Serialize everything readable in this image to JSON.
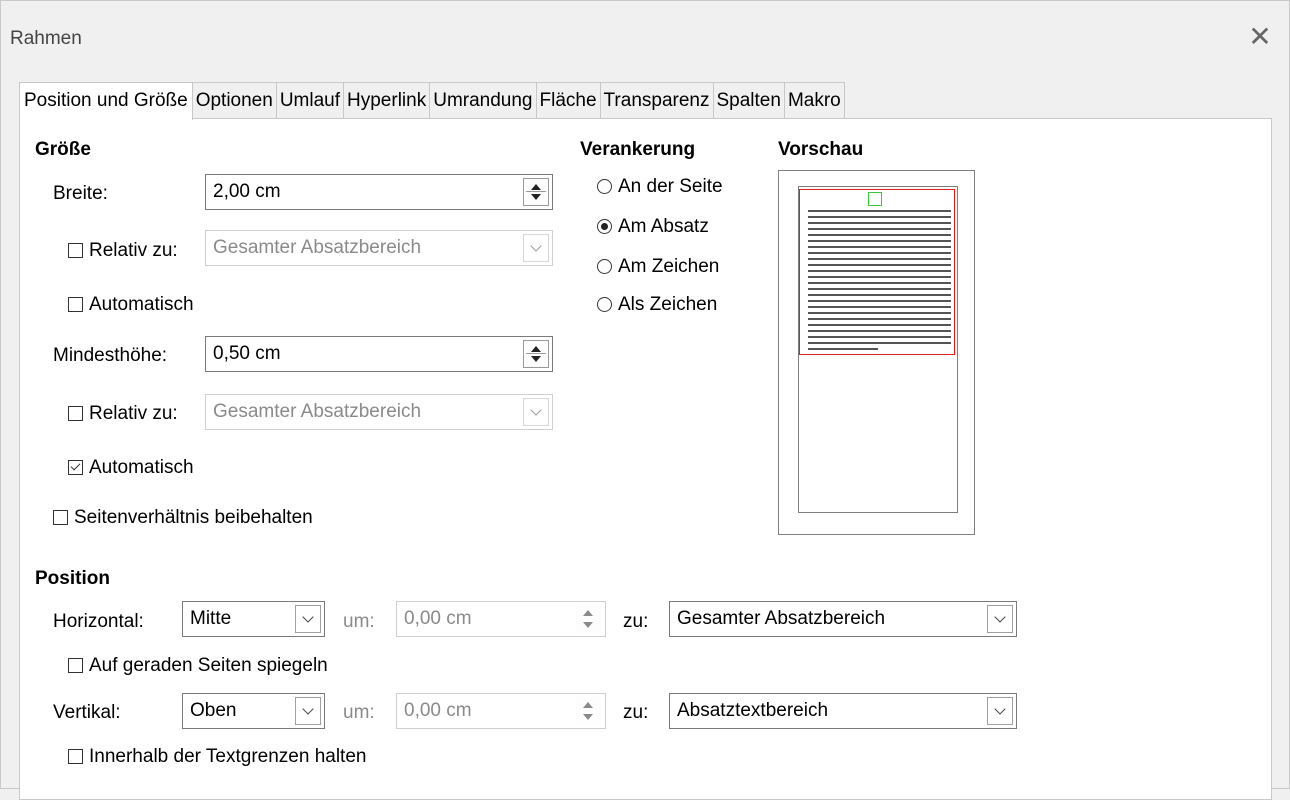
{
  "window": {
    "title": "Rahmen",
    "close_icon": "close-icon"
  },
  "tabs": [
    {
      "label": "Position und Größe",
      "active": true
    },
    {
      "label": "Optionen"
    },
    {
      "label": "Umlauf"
    },
    {
      "label": "Hyperlink"
    },
    {
      "label": "Umrandung"
    },
    {
      "label": "Fläche"
    },
    {
      "label": "Transparenz"
    },
    {
      "label": "Spalten"
    },
    {
      "label": "Makro"
    }
  ],
  "size": {
    "heading": "Größe",
    "width_label": "Breite:",
    "width_value": "2,00 cm",
    "width_relative_label": "Relativ zu:",
    "width_relative_checked": false,
    "width_relative_value": "Gesamter Absatzbereich",
    "width_auto_label": "Automatisch",
    "width_auto_checked": false,
    "minheight_label": "Mindesthöhe:",
    "minheight_value": "0,50 cm",
    "height_relative_label": "Relativ zu:",
    "height_relative_checked": false,
    "height_relative_value": "Gesamter Absatzbereich",
    "height_auto_label": "Automatisch",
    "height_auto_checked": true,
    "keep_ratio_label": "Seitenverhältnis beibehalten",
    "keep_ratio_checked": false
  },
  "anchor": {
    "heading": "Verankerung",
    "options": [
      {
        "label": "An der Seite",
        "selected": false
      },
      {
        "label": "Am Absatz",
        "selected": true
      },
      {
        "label": "Am Zeichen",
        "selected": false
      },
      {
        "label": "Als Zeichen",
        "selected": false
      }
    ]
  },
  "preview": {
    "heading": "Vorschau"
  },
  "position": {
    "heading": "Position",
    "horizontal_label": "Horizontal:",
    "horizontal_value": "Mitte",
    "horizontal_by_label": "um:",
    "horizontal_by_value": "0,00 cm",
    "horizontal_to_label": "zu:",
    "horizontal_to_value": "Gesamter Absatzbereich",
    "mirror_label": "Auf geraden Seiten spiegeln",
    "mirror_checked": false,
    "vertical_label": "Vertikal:",
    "vertical_value": "Oben",
    "vertical_by_label": "um:",
    "vertical_by_value": "0,00 cm",
    "vertical_to_label": "zu:",
    "vertical_to_value": "Absatztextbereich",
    "keep_inside_label": "Innerhalb der Textgrenzen halten",
    "keep_inside_checked": false
  }
}
